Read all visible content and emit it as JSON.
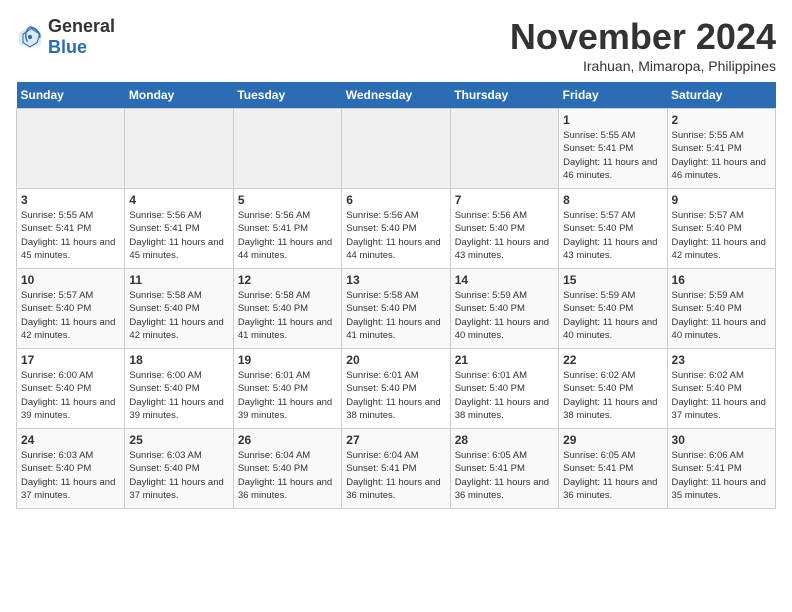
{
  "header": {
    "logo_general": "General",
    "logo_blue": "Blue",
    "month_title": "November 2024",
    "location": "Irahuan, Mimaropa, Philippines"
  },
  "days_of_week": [
    "Sunday",
    "Monday",
    "Tuesday",
    "Wednesday",
    "Thursday",
    "Friday",
    "Saturday"
  ],
  "weeks": [
    [
      {
        "day": "",
        "info": ""
      },
      {
        "day": "",
        "info": ""
      },
      {
        "day": "",
        "info": ""
      },
      {
        "day": "",
        "info": ""
      },
      {
        "day": "",
        "info": ""
      },
      {
        "day": "1",
        "info": "Sunrise: 5:55 AM\nSunset: 5:41 PM\nDaylight: 11 hours and 46 minutes."
      },
      {
        "day": "2",
        "info": "Sunrise: 5:55 AM\nSunset: 5:41 PM\nDaylight: 11 hours and 46 minutes."
      }
    ],
    [
      {
        "day": "3",
        "info": "Sunrise: 5:55 AM\nSunset: 5:41 PM\nDaylight: 11 hours and 45 minutes."
      },
      {
        "day": "4",
        "info": "Sunrise: 5:56 AM\nSunset: 5:41 PM\nDaylight: 11 hours and 45 minutes."
      },
      {
        "day": "5",
        "info": "Sunrise: 5:56 AM\nSunset: 5:41 PM\nDaylight: 11 hours and 44 minutes."
      },
      {
        "day": "6",
        "info": "Sunrise: 5:56 AM\nSunset: 5:40 PM\nDaylight: 11 hours and 44 minutes."
      },
      {
        "day": "7",
        "info": "Sunrise: 5:56 AM\nSunset: 5:40 PM\nDaylight: 11 hours and 43 minutes."
      },
      {
        "day": "8",
        "info": "Sunrise: 5:57 AM\nSunset: 5:40 PM\nDaylight: 11 hours and 43 minutes."
      },
      {
        "day": "9",
        "info": "Sunrise: 5:57 AM\nSunset: 5:40 PM\nDaylight: 11 hours and 42 minutes."
      }
    ],
    [
      {
        "day": "10",
        "info": "Sunrise: 5:57 AM\nSunset: 5:40 PM\nDaylight: 11 hours and 42 minutes."
      },
      {
        "day": "11",
        "info": "Sunrise: 5:58 AM\nSunset: 5:40 PM\nDaylight: 11 hours and 42 minutes."
      },
      {
        "day": "12",
        "info": "Sunrise: 5:58 AM\nSunset: 5:40 PM\nDaylight: 11 hours and 41 minutes."
      },
      {
        "day": "13",
        "info": "Sunrise: 5:58 AM\nSunset: 5:40 PM\nDaylight: 11 hours and 41 minutes."
      },
      {
        "day": "14",
        "info": "Sunrise: 5:59 AM\nSunset: 5:40 PM\nDaylight: 11 hours and 40 minutes."
      },
      {
        "day": "15",
        "info": "Sunrise: 5:59 AM\nSunset: 5:40 PM\nDaylight: 11 hours and 40 minutes."
      },
      {
        "day": "16",
        "info": "Sunrise: 5:59 AM\nSunset: 5:40 PM\nDaylight: 11 hours and 40 minutes."
      }
    ],
    [
      {
        "day": "17",
        "info": "Sunrise: 6:00 AM\nSunset: 5:40 PM\nDaylight: 11 hours and 39 minutes."
      },
      {
        "day": "18",
        "info": "Sunrise: 6:00 AM\nSunset: 5:40 PM\nDaylight: 11 hours and 39 minutes."
      },
      {
        "day": "19",
        "info": "Sunrise: 6:01 AM\nSunset: 5:40 PM\nDaylight: 11 hours and 39 minutes."
      },
      {
        "day": "20",
        "info": "Sunrise: 6:01 AM\nSunset: 5:40 PM\nDaylight: 11 hours and 38 minutes."
      },
      {
        "day": "21",
        "info": "Sunrise: 6:01 AM\nSunset: 5:40 PM\nDaylight: 11 hours and 38 minutes."
      },
      {
        "day": "22",
        "info": "Sunrise: 6:02 AM\nSunset: 5:40 PM\nDaylight: 11 hours and 38 minutes."
      },
      {
        "day": "23",
        "info": "Sunrise: 6:02 AM\nSunset: 5:40 PM\nDaylight: 11 hours and 37 minutes."
      }
    ],
    [
      {
        "day": "24",
        "info": "Sunrise: 6:03 AM\nSunset: 5:40 PM\nDaylight: 11 hours and 37 minutes."
      },
      {
        "day": "25",
        "info": "Sunrise: 6:03 AM\nSunset: 5:40 PM\nDaylight: 11 hours and 37 minutes."
      },
      {
        "day": "26",
        "info": "Sunrise: 6:04 AM\nSunset: 5:40 PM\nDaylight: 11 hours and 36 minutes."
      },
      {
        "day": "27",
        "info": "Sunrise: 6:04 AM\nSunset: 5:41 PM\nDaylight: 11 hours and 36 minutes."
      },
      {
        "day": "28",
        "info": "Sunrise: 6:05 AM\nSunset: 5:41 PM\nDaylight: 11 hours and 36 minutes."
      },
      {
        "day": "29",
        "info": "Sunrise: 6:05 AM\nSunset: 5:41 PM\nDaylight: 11 hours and 36 minutes."
      },
      {
        "day": "30",
        "info": "Sunrise: 6:06 AM\nSunset: 5:41 PM\nDaylight: 11 hours and 35 minutes."
      }
    ]
  ]
}
